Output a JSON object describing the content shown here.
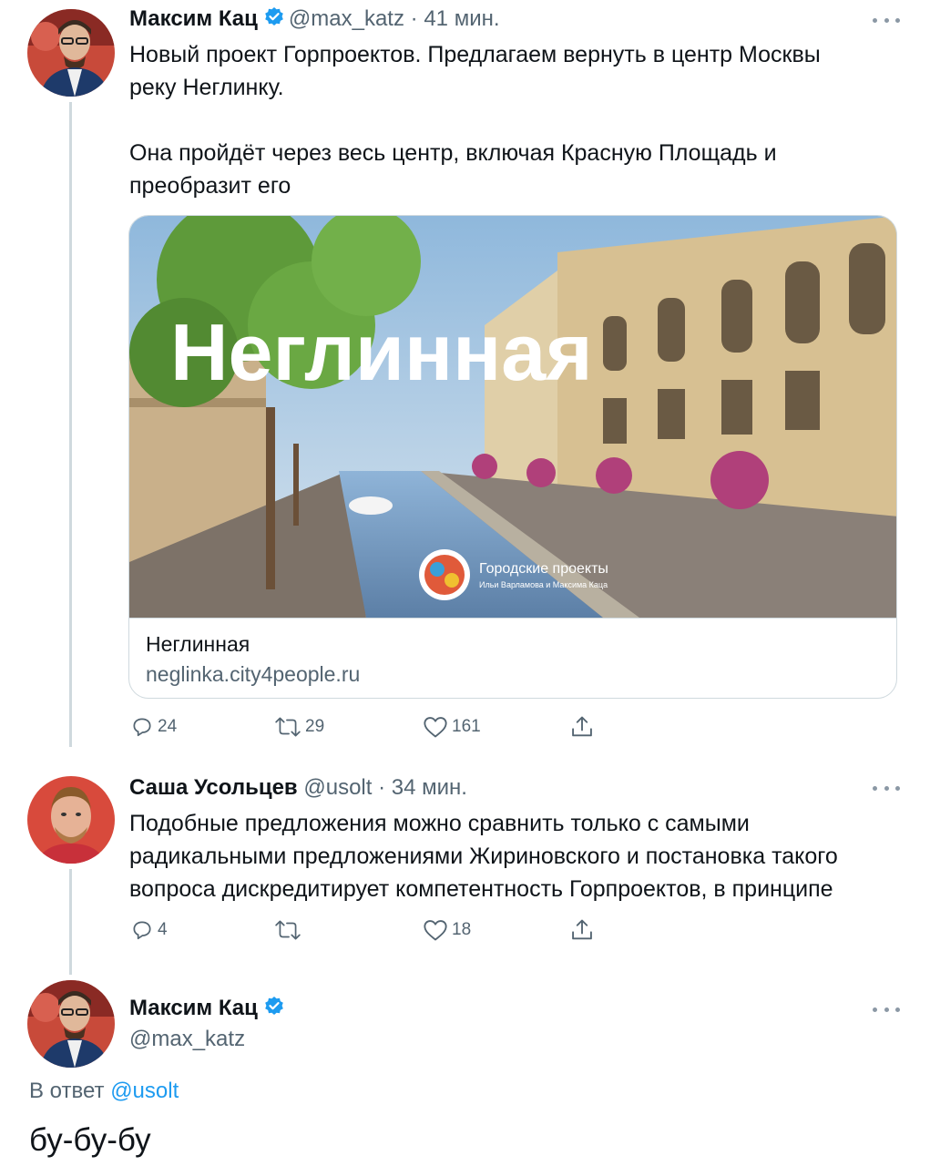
{
  "tweet1": {
    "name": "Максим Кац",
    "handle": "@max_katz",
    "dot": "·",
    "time": "41 мин.",
    "text_line1": "Новый проект Горпроектов. Предлагаем вернуть в центр Москвы",
    "text_line2": "реку Неглинку.",
    "text_line3": "Она пройдёт через весь центр, включая Красную Площадь и",
    "text_line4": "преобразит его",
    "card": {
      "image_overlay_title": "Неглинная",
      "logo_text": "Городские проекты",
      "logo_subtext": "Ильи Варламова и Максима Каца",
      "title": "Неглинная",
      "url": "neglinka.city4people.ru"
    },
    "reply_count": "24",
    "retweet_count": "29",
    "like_count": "161"
  },
  "tweet2": {
    "name": "Саша Усольцев",
    "handle": "@usolt",
    "dot": "·",
    "time": "34 мин.",
    "text_line1": "Подобные предложения можно сравнить только с самыми",
    "text_line2": "радикальными предложениями Жириновского и постановка такого",
    "text_line3": "вопроса дискредитирует компетентность Горпроектов, в принципе",
    "reply_count": "4",
    "like_count": "18"
  },
  "tweet3": {
    "name": "Максим Кац",
    "handle": "@max_katz",
    "reply_prefix": "В ответ",
    "reply_mention": "@usolt",
    "text": "бу-бу-бу"
  },
  "colors": {
    "verified": "#1d9bf0",
    "secondary_text": "#536471",
    "link": "#1d9bf0",
    "thread_line": "#cfd9de"
  },
  "icons": [
    "verified-badge-icon",
    "more-icon",
    "reply-icon",
    "retweet-icon",
    "like-icon",
    "share-icon"
  ]
}
